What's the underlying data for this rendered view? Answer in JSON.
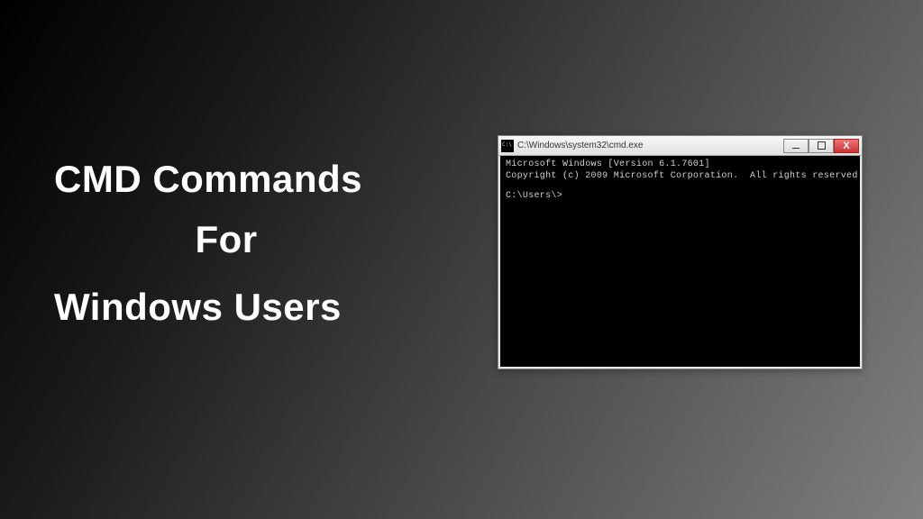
{
  "heading": {
    "line1": "CMD Commands",
    "line2": "For",
    "line3": "Windows Users"
  },
  "cmd_window": {
    "title": "C:\\Windows\\system32\\cmd.exe",
    "terminal": {
      "line1": "Microsoft Windows [Version 6.1.7601]",
      "line2": "Copyright (c) 2009 Microsoft Corporation.  All rights reserved.",
      "prompt": "C:\\Users\\>"
    },
    "controls": {
      "close_label": "X"
    }
  }
}
